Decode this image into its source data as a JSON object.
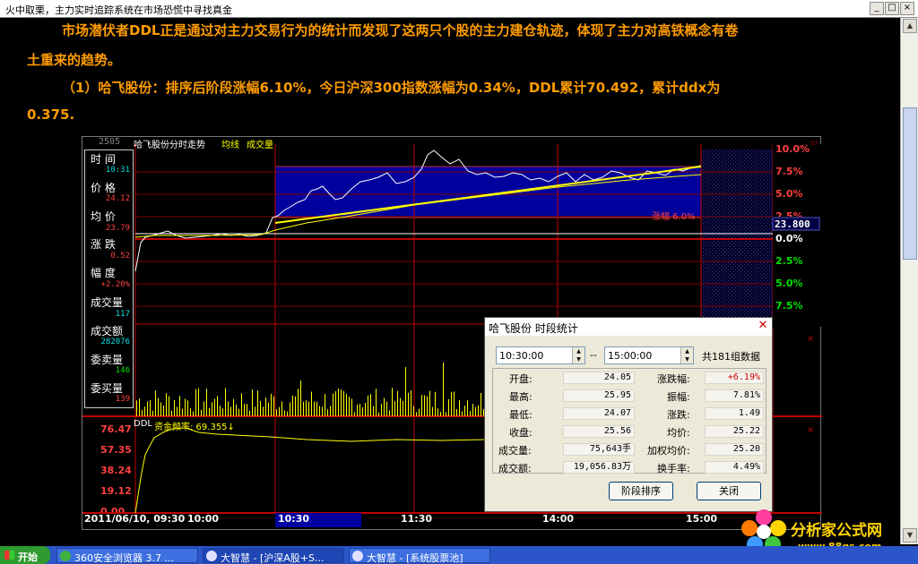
{
  "window": {
    "title": "火中取栗，主力实时追踪系统在市场恐慌中寻找真金"
  },
  "article": {
    "para1_line1": "市场潜伏者DDL正是通过对主力交易行为的统计而发现了这两只个股的主力建仓轨迹，体现了主力对高铁概念有卷",
    "para1_line2": "土重来的趋势。",
    "para2_line1": "（1）哈飞股份：排序后阶段涨幅6.10%，今日沪深300指数涨幅为0.34%，DDL累计70.492，累计ddx为",
    "para2_line2": "0.375."
  },
  "chart": {
    "header": "哈飞股份分时走势",
    "legend_avg": "均线",
    "legend_vol": "成交量",
    "header_price_partial": "2505",
    "pct_labels_up": [
      "10.0%",
      "7.5%",
      "5.0%",
      "2.5%"
    ],
    "zero_label": "0.0%",
    "pct_labels_down": [
      "2.5%",
      "5.0%",
      "7.5%"
    ],
    "cursor_price": "23.800",
    "range_label": "涨幅 6.0%",
    "ddl_label": "DDL",
    "ddl_freq": "资金频率: 69.355↓",
    "ddl_axis": [
      "76.47",
      "57.35",
      "38.24",
      "19.12",
      "0.00"
    ],
    "time_axis": [
      "2011/06/10, 09:30",
      "10:00",
      "10:30",
      "11:30",
      "14:00",
      "15:00"
    ],
    "colors": {
      "grid": "#c00000",
      "price_line": "#ffffff",
      "avg_line": "#ffff00",
      "volume": "#ffff00",
      "selection": "#00009c"
    }
  },
  "info_panel": {
    "time_label": "时  间",
    "time_value": "10:31",
    "price_label": "价  格",
    "price_value": "24.12",
    "avg_label": "均  价",
    "avg_value": "23.79",
    "change_label": "涨  跌",
    "change_value": "0.52",
    "range_label": "幅  度",
    "range_value": "+2.20%",
    "volume_label": "成交量",
    "volume_value": "117",
    "amount_label": "成交额",
    "amount_value": "282076",
    "sell_label": "委卖量",
    "sell_value": "146",
    "buy_label": "委买量",
    "buy_value": "139"
  },
  "dialog": {
    "title": "哈飞股份 时段统计",
    "start_time": "10:30:00",
    "end_time": "15:00:00",
    "separator": "--",
    "count_text": "共181组数据",
    "stats_left": [
      {
        "label": "开盘:",
        "value": "24.05"
      },
      {
        "label": "最高:",
        "value": "25.95"
      },
      {
        "label": "最低:",
        "value": "24.07"
      },
      {
        "label": "收盘:",
        "value": "25.56"
      },
      {
        "label": "成交量:",
        "value": "75,643手"
      },
      {
        "label": "成交额:",
        "value": "19,056.83万"
      }
    ],
    "stats_right": [
      {
        "label": "涨跌幅:",
        "value": "+6.19%"
      },
      {
        "label": "振幅:",
        "value": "7.81%"
      },
      {
        "label": "涨跌:",
        "value": "1.49"
      },
      {
        "label": "均价:",
        "value": "25.22"
      },
      {
        "label": "加权均价:",
        "value": "25.20"
      },
      {
        "label": "换手率:",
        "value": "4.49%"
      }
    ],
    "sort_button": "阶段排序",
    "close_button": "关闭"
  },
  "taskbar": {
    "start": "开始",
    "tasks": [
      "360安全浏览器 3.7 ...",
      "大智慧 - [沪深A股+S...",
      "大智慧 - [系统股票池]"
    ]
  },
  "logo": {
    "name": "分析家公式网",
    "url": "www.88gs.com"
  }
}
